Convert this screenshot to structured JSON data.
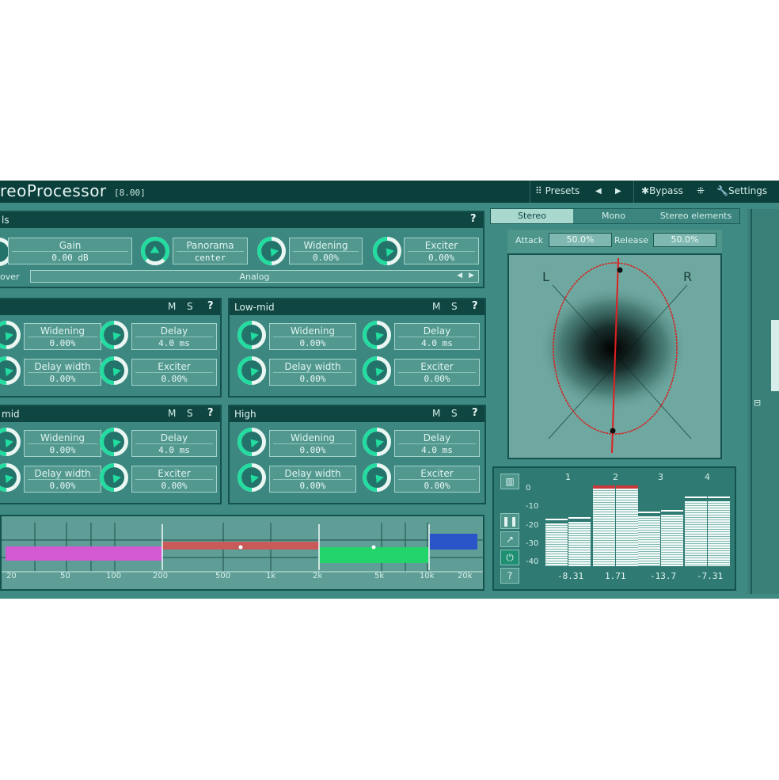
{
  "titlebar": {
    "title": "reoProcessor",
    "version": "[8.00]",
    "presets": "Presets",
    "prev": "◀",
    "next": "▶",
    "bypass": "Bypass",
    "settings": "Settings"
  },
  "global": {
    "title": "ls",
    "help": "?",
    "gain_label": "Gain",
    "gain_value": "0.00 dB",
    "panorama_label": "Panorama",
    "panorama_value": "center",
    "widening_label": "Widening",
    "widening_value": "0.00%",
    "exciter_label": "Exciter",
    "exciter_value": "0.00%",
    "crossover_label": "over",
    "crossover_value": "Analog",
    "crossover_prev": "◀",
    "crossover_next": "▶"
  },
  "bands": [
    {
      "title": "",
      "m": "M",
      "s": "S",
      "help": "?",
      "widening_label": "Widening",
      "widening_value": "0.00%",
      "delay_label": "Delay",
      "delay_value": "4.0 ms",
      "delaywidth_label": "Delay width",
      "delaywidth_value": "0.00%",
      "exciter_label": "Exciter",
      "exciter_value": "0.00%"
    },
    {
      "title": "Low-mid",
      "m": "M",
      "s": "S",
      "help": "?",
      "widening_label": "Widening",
      "widening_value": "0.00%",
      "delay_label": "Delay",
      "delay_value": "4.0 ms",
      "delaywidth_label": "Delay width",
      "delaywidth_value": "0.00%",
      "exciter_label": "Exciter",
      "exciter_value": "0.00%"
    },
    {
      "title": "mid",
      "m": "M",
      "s": "S",
      "help": "?",
      "widening_label": "Widening",
      "widening_value": "0.00%",
      "delay_label": "Delay",
      "delay_value": "4.0 ms",
      "delaywidth_label": "Delay width",
      "delaywidth_value": "0.00%",
      "exciter_label": "Exciter",
      "exciter_value": "0.00%"
    },
    {
      "title": "High",
      "m": "M",
      "s": "S",
      "help": "?",
      "widening_label": "Widening",
      "widening_value": "0.00%",
      "delay_label": "Delay",
      "delay_value": "4.0 ms",
      "delaywidth_label": "Delay width",
      "delaywidth_value": "0.00%",
      "exciter_label": "Exciter",
      "exciter_value": "0.00%"
    }
  ],
  "tabs": [
    "Stereo",
    "Mono",
    "Stereo elements"
  ],
  "scope": {
    "attack_label": "Attack",
    "attack_value": "50.0%",
    "release_label": "Release",
    "release_value": "50.0%",
    "left": "L",
    "right": "R"
  },
  "meter": {
    "channels": [
      "1",
      "2",
      "3",
      "4"
    ],
    "scale": [
      "0",
      "-10",
      "-20",
      "-30",
      "-40"
    ],
    "peaks": [
      "-8.31",
      "1.71",
      "-13.7",
      "-7.31"
    ],
    "levels_db": [
      [
        -19,
        -18
      ],
      [
        2,
        2
      ],
      [
        -15,
        -14
      ],
      [
        -7,
        -7
      ]
    ],
    "help": "?"
  },
  "freq": {
    "labels": [
      "20",
      "50",
      "100",
      "200",
      "500",
      "1k",
      "2k",
      "5k",
      "10k",
      "20k"
    ]
  },
  "colors": {
    "accent": "#22dca0",
    "band1": "#d45ad4",
    "band2": "#c85a5a",
    "band3": "#22d46a",
    "band4": "#2a55c8",
    "ellipse": "#d82020"
  }
}
